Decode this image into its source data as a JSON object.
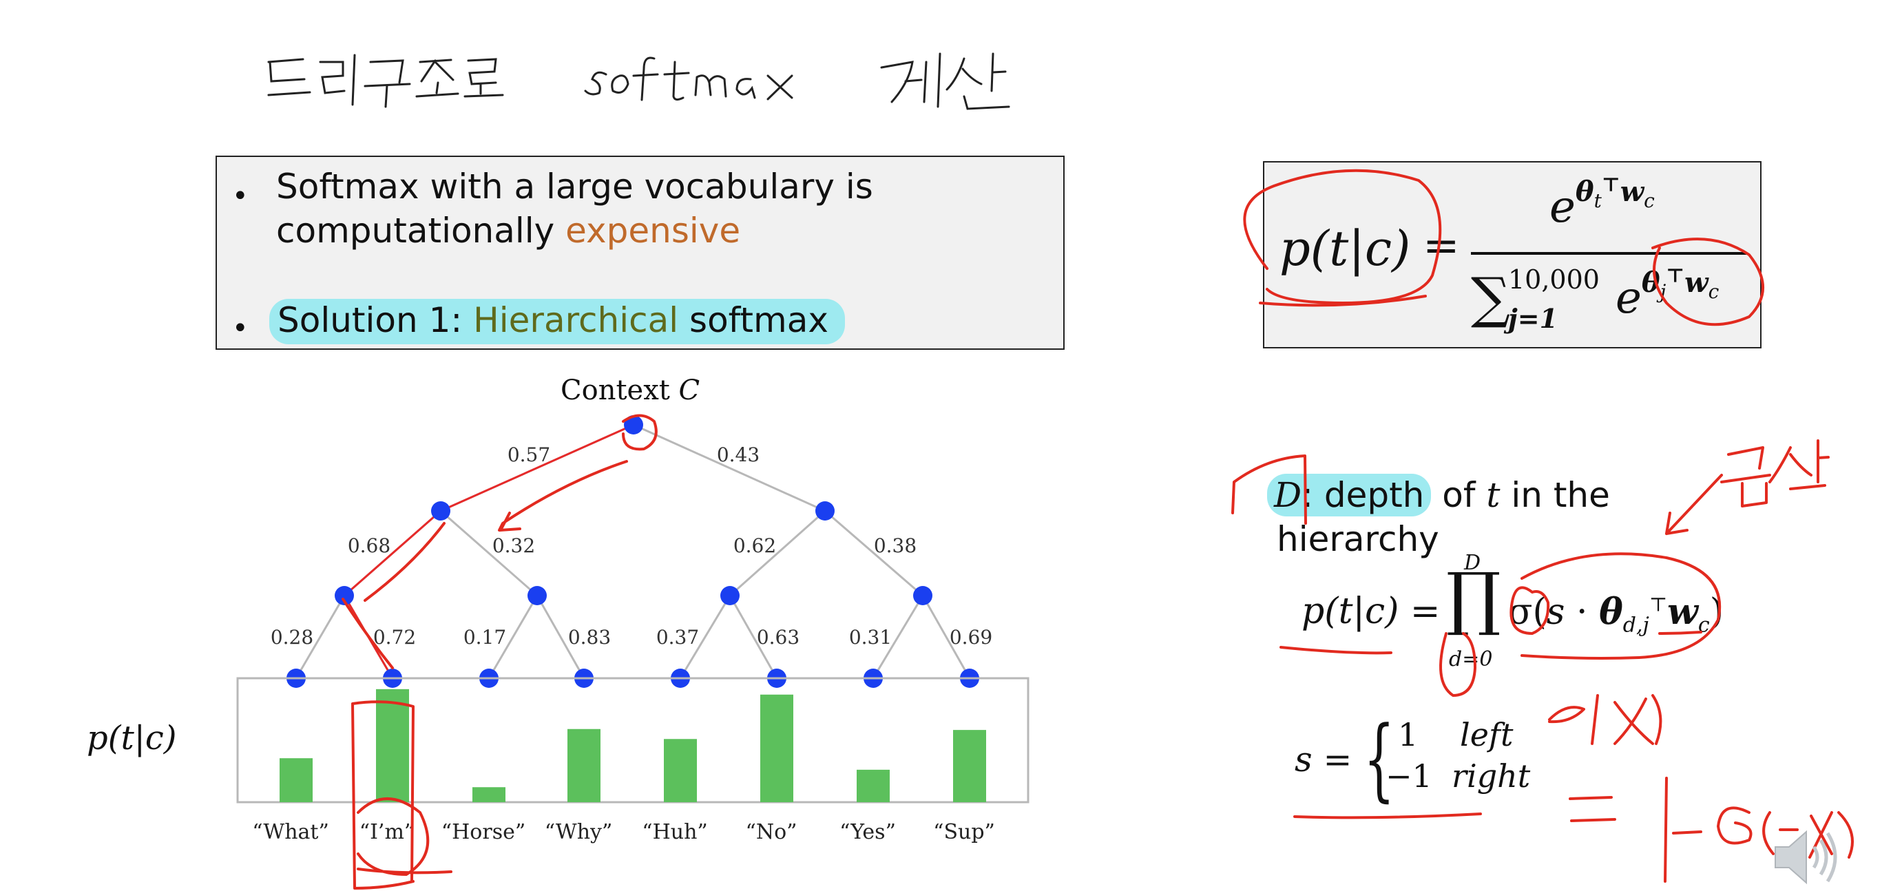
{
  "handwritten_title": {
    "part1": "트리구조로",
    "part2": "softmax",
    "part3": "계산"
  },
  "bullets": {
    "b1_line1": "Softmax with a large vocabulary is",
    "b1_line2_a": "computationally ",
    "b1_line2_b": "expensive",
    "b2_a": "Solution 1:  ",
    "b2_b": "Hierarchical",
    "b2_c": " softmax"
  },
  "formula_box": {
    "lhs": "p(t|c)",
    "eq": "=",
    "num_base": "e",
    "num_exp": "θ",
    "num_exp_sub": "t",
    "num_exp_sup": "⊤",
    "num_exp_w": "w",
    "num_exp_w_sub": "c",
    "den_sum": "∑",
    "den_sum_top": "10,000",
    "den_sum_bottom": "j=1",
    "den_base": "e",
    "den_exp": "θ",
    "den_exp_sub": "j",
    "den_exp_sup": "⊤",
    "den_exp_w": "w",
    "den_exp_w_sub": "c"
  },
  "tree": {
    "context_label": "Context ",
    "context_var": "C",
    "edge_labels": [
      "0.57",
      "0.43",
      "0.68",
      "0.32",
      "0.62",
      "0.38",
      "0.28",
      "0.72",
      "0.17",
      "0.83",
      "0.37",
      "0.63",
      "0.31",
      "0.69"
    ],
    "leaves": [
      "“What”",
      "“I’m”",
      "“Horse”",
      "“Why”",
      "“Huh”",
      "“No”",
      "“Yes”",
      "“Sup”"
    ],
    "leaf_probs": [
      0.1596,
      0.4104,
      0.0544,
      0.2656,
      0.2294,
      0.3906,
      0.1178,
      0.2622
    ],
    "y_label": "p(t|c)",
    "colors": {
      "node": "#1a3ff0",
      "bar": "#5cc05c",
      "edge": "#b8b8b8",
      "highlight": "#e62a2a"
    }
  },
  "right_text": {
    "depth_var": "D",
    "depth_text": ": depth",
    "depth_rest_a": " of ",
    "depth_rest_t": "t",
    "depth_rest_b": " in the",
    "depth_line2": "hierarchy",
    "prod_lhs": "p(t|c) =",
    "prod_top": "D",
    "prod_bottom": "d=0",
    "prod_symbol": "∏",
    "prod_rhs_a": "σ(",
    "prod_rhs_s": "s",
    "prod_rhs_dot": " · ",
    "prod_rhs_theta": "θ",
    "prod_rhs_sub": "d,j",
    "prod_rhs_sup": "⊤",
    "prod_rhs_w": "w",
    "prod_rhs_wsub": "c",
    "prod_rhs_close": ")",
    "s_lhs": "s =",
    "s_case1_val": "1",
    "s_case1_label": "left",
    "s_case2_val": "−1",
    "s_case2_label": "right"
  },
  "annotations": {
    "multiply_note": "곱셈",
    "sigma_x": "σ(x)",
    "one_minus": "= 1−σ(−x)"
  },
  "icons": {
    "speaker": "speaker-icon"
  }
}
